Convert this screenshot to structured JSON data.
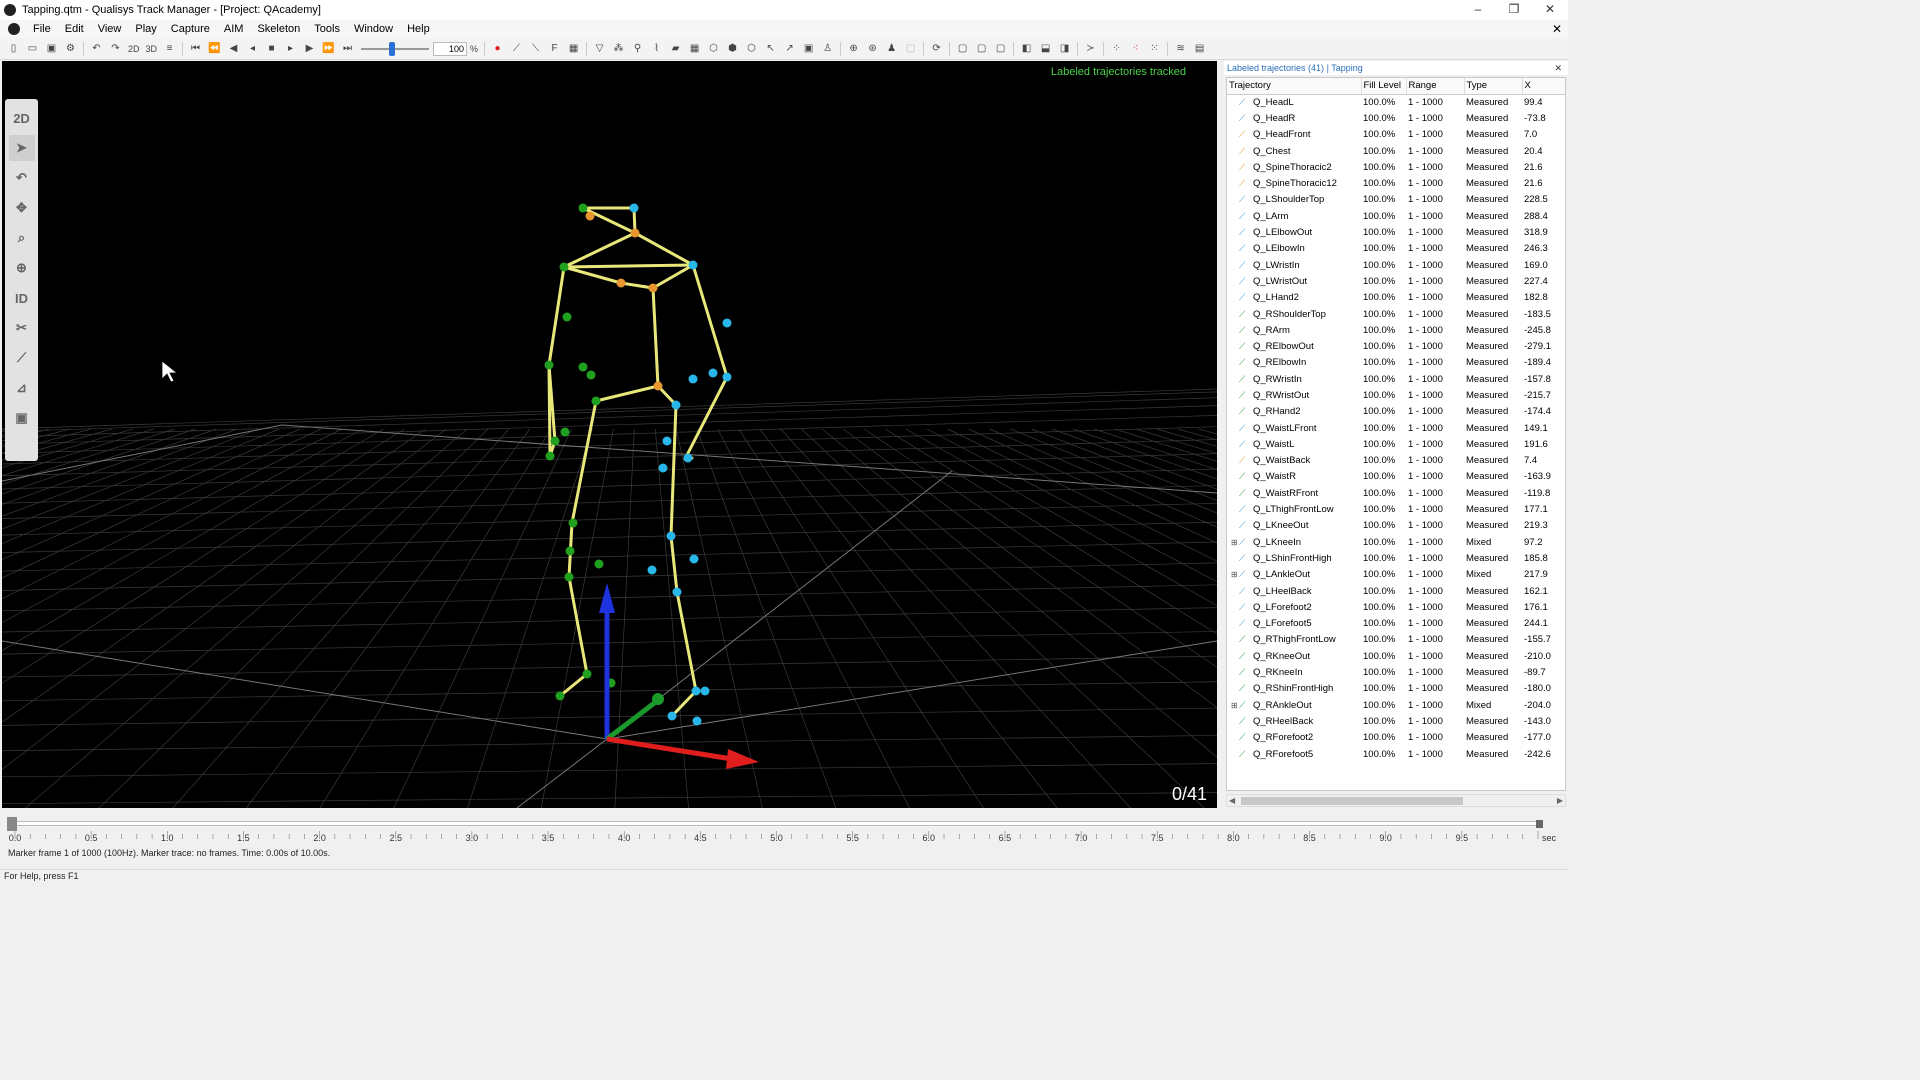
{
  "window": {
    "title": "Tapping.qtm - Qualisys Track Manager - [Project: QAcademy]",
    "minimize": "–",
    "restore": "❐",
    "close": "✕"
  },
  "menu": [
    "File",
    "Edit",
    "View",
    "Play",
    "Capture",
    "AIM",
    "Skeleton",
    "Tools",
    "Window",
    "Help"
  ],
  "toolbar": {
    "speed_value": "100",
    "speed_unit": "%",
    "label_2d": "2D",
    "label_3d": "3D",
    "speed_fraction": 0.45
  },
  "left_tools": [
    {
      "name": "2d-view-button",
      "label": "2D"
    },
    {
      "name": "select-tool",
      "label": "➤",
      "active": true
    },
    {
      "name": "rotate-tool",
      "label": "↶"
    },
    {
      "name": "translate-tool",
      "label": "✥"
    },
    {
      "name": "zoom-tool",
      "label": "⌕"
    },
    {
      "name": "center-tool",
      "label": "⊕"
    },
    {
      "name": "identify-tool",
      "label": "ID"
    },
    {
      "name": "cut-tool",
      "label": "✂"
    },
    {
      "name": "trajectory-tool",
      "label": "⟋"
    },
    {
      "name": "gap-tool",
      "label": "⊿"
    },
    {
      "name": "box-tool",
      "label": "▣"
    }
  ],
  "viewport": {
    "status": "Labeled trajectories tracked",
    "counter": "0/41"
  },
  "panel": {
    "title": "Labeled trajectories (41)",
    "separator": "|",
    "file": "Tapping",
    "close": "✕",
    "columns": [
      "Trajectory",
      "Fill Level",
      "Range",
      "Type",
      "X"
    ],
    "rows": [
      {
        "name": "Q_HeadL",
        "fill": "100.0%",
        "range": "1 - 1000",
        "type": "Measured",
        "x": "99.4",
        "color": "#3a9bd6"
      },
      {
        "name": "Q_HeadR",
        "fill": "100.0%",
        "range": "1 - 1000",
        "type": "Measured",
        "x": "-73.8",
        "color": "#3a9bd6"
      },
      {
        "name": "Q_HeadFront",
        "fill": "100.0%",
        "range": "1 - 1000",
        "type": "Measured",
        "x": "7.0",
        "color": "#e8962e"
      },
      {
        "name": "Q_Chest",
        "fill": "100.0%",
        "range": "1 - 1000",
        "type": "Measured",
        "x": "20.4",
        "color": "#e8962e"
      },
      {
        "name": "Q_SpineThoracic2",
        "fill": "100.0%",
        "range": "1 - 1000",
        "type": "Measured",
        "x": "21.6",
        "color": "#e8962e"
      },
      {
        "name": "Q_SpineThoracic12",
        "fill": "100.0%",
        "range": "1 - 1000",
        "type": "Measured",
        "x": "21.6",
        "color": "#e8962e"
      },
      {
        "name": "Q_LShoulderTop",
        "fill": "100.0%",
        "range": "1 - 1000",
        "type": "Measured",
        "x": "228.5",
        "color": "#3a9bd6"
      },
      {
        "name": "Q_LArm",
        "fill": "100.0%",
        "range": "1 - 1000",
        "type": "Measured",
        "x": "288.4",
        "color": "#3a9bd6"
      },
      {
        "name": "Q_LElbowOut",
        "fill": "100.0%",
        "range": "1 - 1000",
        "type": "Measured",
        "x": "318.9",
        "color": "#3a9bd6"
      },
      {
        "name": "Q_LElbowIn",
        "fill": "100.0%",
        "range": "1 - 1000",
        "type": "Measured",
        "x": "246.3",
        "color": "#3a9bd6"
      },
      {
        "name": "Q_LWristIn",
        "fill": "100.0%",
        "range": "1 - 1000",
        "type": "Measured",
        "x": "169.0",
        "color": "#3a9bd6"
      },
      {
        "name": "Q_LWristOut",
        "fill": "100.0%",
        "range": "1 - 1000",
        "type": "Measured",
        "x": "227.4",
        "color": "#3a9bd6"
      },
      {
        "name": "Q_LHand2",
        "fill": "100.0%",
        "range": "1 - 1000",
        "type": "Measured",
        "x": "182.8",
        "color": "#3a9bd6"
      },
      {
        "name": "Q_RShoulderTop",
        "fill": "100.0%",
        "range": "1 - 1000",
        "type": "Measured",
        "x": "-183.5",
        "color": "#2e9e3e"
      },
      {
        "name": "Q_RArm",
        "fill": "100.0%",
        "range": "1 - 1000",
        "type": "Measured",
        "x": "-245.8",
        "color": "#2e9e3e"
      },
      {
        "name": "Q_RElbowOut",
        "fill": "100.0%",
        "range": "1 - 1000",
        "type": "Measured",
        "x": "-279.1",
        "color": "#2e9e3e"
      },
      {
        "name": "Q_RElbowIn",
        "fill": "100.0%",
        "range": "1 - 1000",
        "type": "Measured",
        "x": "-189.4",
        "color": "#2e9e3e"
      },
      {
        "name": "Q_RWristIn",
        "fill": "100.0%",
        "range": "1 - 1000",
        "type": "Measured",
        "x": "-157.8",
        "color": "#2e9e3e"
      },
      {
        "name": "Q_RWristOut",
        "fill": "100.0%",
        "range": "1 - 1000",
        "type": "Measured",
        "x": "-215.7",
        "color": "#2e9e3e"
      },
      {
        "name": "Q_RHand2",
        "fill": "100.0%",
        "range": "1 - 1000",
        "type": "Measured",
        "x": "-174.4",
        "color": "#2e9e3e"
      },
      {
        "name": "Q_WaistLFront",
        "fill": "100.0%",
        "range": "1 - 1000",
        "type": "Measured",
        "x": "149.1",
        "color": "#3a9bd6"
      },
      {
        "name": "Q_WaistL",
        "fill": "100.0%",
        "range": "1 - 1000",
        "type": "Measured",
        "x": "191.6",
        "color": "#3a9bd6"
      },
      {
        "name": "Q_WaistBack",
        "fill": "100.0%",
        "range": "1 - 1000",
        "type": "Measured",
        "x": "7.4",
        "color": "#e8962e"
      },
      {
        "name": "Q_WaistR",
        "fill": "100.0%",
        "range": "1 - 1000",
        "type": "Measured",
        "x": "-163.9",
        "color": "#2e9e3e"
      },
      {
        "name": "Q_WaistRFront",
        "fill": "100.0%",
        "range": "1 - 1000",
        "type": "Measured",
        "x": "-119.8",
        "color": "#2e9e3e"
      },
      {
        "name": "Q_LThighFrontLow",
        "fill": "100.0%",
        "range": "1 - 1000",
        "type": "Measured",
        "x": "177.1",
        "color": "#3a9bd6"
      },
      {
        "name": "Q_LKneeOut",
        "fill": "100.0%",
        "range": "1 - 1000",
        "type": "Measured",
        "x": "219.3",
        "color": "#3a9bd6"
      },
      {
        "name": "Q_LKneeIn",
        "fill": "100.0%",
        "range": "1 - 1000",
        "type": "Mixed",
        "x": "97.2",
        "color": "#3a9bd6",
        "expandable": true
      },
      {
        "name": "Q_LShinFrontHigh",
        "fill": "100.0%",
        "range": "1 - 1000",
        "type": "Measured",
        "x": "185.8",
        "color": "#3a9bd6"
      },
      {
        "name": "Q_LAnkleOut",
        "fill": "100.0%",
        "range": "1 - 1000",
        "type": "Mixed",
        "x": "217.9",
        "color": "#3a9bd6",
        "expandable": true
      },
      {
        "name": "Q_LHeelBack",
        "fill": "100.0%",
        "range": "1 - 1000",
        "type": "Measured",
        "x": "162.1",
        "color": "#3a9bd6"
      },
      {
        "name": "Q_LForefoot2",
        "fill": "100.0%",
        "range": "1 - 1000",
        "type": "Measured",
        "x": "176.1",
        "color": "#3a9bd6"
      },
      {
        "name": "Q_LForefoot5",
        "fill": "100.0%",
        "range": "1 - 1000",
        "type": "Measured",
        "x": "244.1",
        "color": "#3a9bd6"
      },
      {
        "name": "Q_RThighFrontLow",
        "fill": "100.0%",
        "range": "1 - 1000",
        "type": "Measured",
        "x": "-155.7",
        "color": "#2e9e3e"
      },
      {
        "name": "Q_RKneeOut",
        "fill": "100.0%",
        "range": "1 - 1000",
        "type": "Measured",
        "x": "-210.0",
        "color": "#2e9e3e"
      },
      {
        "name": "Q_RKneeIn",
        "fill": "100.0%",
        "range": "1 - 1000",
        "type": "Measured",
        "x": "-89.7",
        "color": "#2e9e3e"
      },
      {
        "name": "Q_RShinFrontHigh",
        "fill": "100.0%",
        "range": "1 - 1000",
        "type": "Measured",
        "x": "-180.0",
        "color": "#2e9e3e"
      },
      {
        "name": "Q_RAnkleOut",
        "fill": "100.0%",
        "range": "1 - 1000",
        "type": "Mixed",
        "x": "-204.0",
        "color": "#2e9e3e",
        "expandable": true
      },
      {
        "name": "Q_RHeelBack",
        "fill": "100.0%",
        "range": "1 - 1000",
        "type": "Measured",
        "x": "-143.0",
        "color": "#2e9e3e"
      },
      {
        "name": "Q_RForefoot2",
        "fill": "100.0%",
        "range": "1 - 1000",
        "type": "Measured",
        "x": "-177.0",
        "color": "#2e9e3e"
      },
      {
        "name": "Q_RForefoot5",
        "fill": "100.0%",
        "range": "1 - 1000",
        "type": "Measured",
        "x": "-242.6",
        "color": "#2e9e3e"
      }
    ]
  },
  "timeline": {
    "ticks": [
      "0.0",
      "0.5",
      "1.0",
      "1.5",
      "2.0",
      "2.5",
      "3.0",
      "3.5",
      "4.0",
      "4.5",
      "5.0",
      "5.5",
      "6.0",
      "6.5",
      "7.0",
      "7.5",
      "8.0",
      "8.5",
      "9.0",
      "9.5"
    ],
    "unit": "sec",
    "info": "Marker frame 1 of 1000 (100Hz). Marker trace: no frames. Time: 0.00s of 10.00s."
  },
  "statusbar": "For Help, press F1",
  "colors": {
    "skeleton_bone": "#e8e87a",
    "marker_left": "#29b6e8",
    "marker_right": "#1fa01f",
    "marker_center": "#e8962e",
    "axis_x": "#e01e1e",
    "axis_y": "#1a9a2a",
    "axis_z": "#1e32e0"
  }
}
